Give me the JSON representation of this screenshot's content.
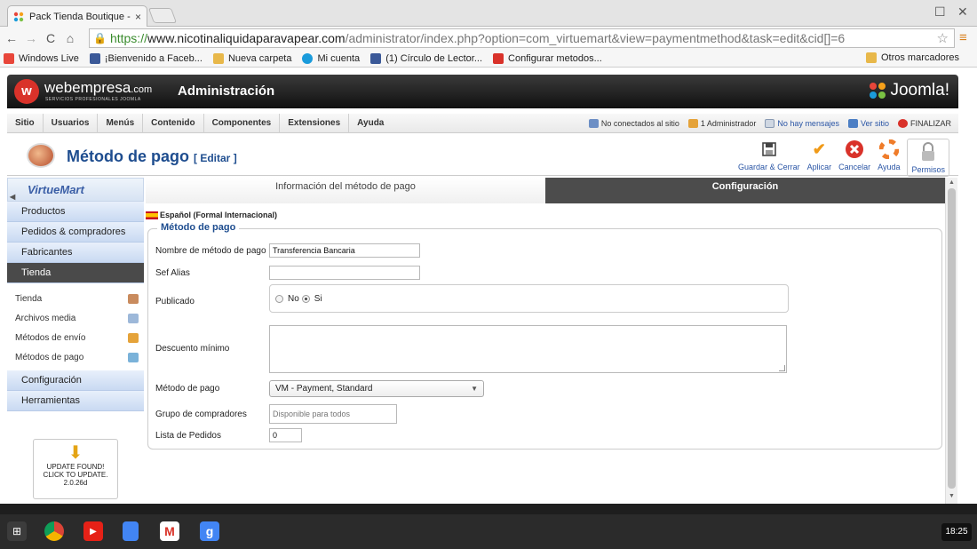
{
  "browser": {
    "tab_title": "Pack Tienda Boutique - Ad",
    "tab_close": "×",
    "url_scheme": "https://",
    "url_host": "www.nicotinaliquidaparavapear.com",
    "url_path": "/administrator/index.php?option=com_virtuemart&view=paymentmethod&task=edit&cid[]=6",
    "bookmarks": [
      {
        "label": "Windows Live",
        "color": "#e8463a"
      },
      {
        "label": "¡Bienvenido a Faceb...",
        "color": "#3b5998"
      },
      {
        "label": "Nueva carpeta",
        "color": "#e8b84a"
      },
      {
        "label": "Mi cuenta",
        "color": "#1a9bdb"
      },
      {
        "label": "(1) Círculo de Lector...",
        "color": "#3b5998"
      },
      {
        "label": "Configurar metodos...",
        "color": "#d9322a"
      }
    ],
    "other_bookmarks": "Otros marcadores"
  },
  "header": {
    "brand": "webempresa",
    "brand_suffix": ".com",
    "brand_sub": "SERVICIOS PROFESIONALES JOOMLA",
    "title": "Administración",
    "cms_logo": "Joomla!"
  },
  "menu": {
    "items": [
      "Sitio",
      "Usuarios",
      "Menús",
      "Contenido",
      "Componentes",
      "Extensiones",
      "Ayuda"
    ],
    "status": {
      "offline": "No conectados al sitio",
      "admins": "1 Administrador",
      "messages": "No hay mensajes",
      "view_site": "Ver sitio",
      "logout": "FINALIZAR"
    }
  },
  "toolbar": {
    "page_title": "Método de pago",
    "page_subtitle": "[ Editar ]",
    "buttons": [
      "Guardar & Cerrar",
      "Aplicar",
      "Cancelar",
      "Ayuda",
      "Permisos"
    ]
  },
  "sidebar": {
    "logo": "VirtueMart",
    "sections": [
      "Productos",
      "Pedidos & compradores",
      "Fabricantes",
      "Tienda",
      "Configuración",
      "Herramientas"
    ],
    "tienda_items": [
      "Tienda",
      "Archivos media",
      "Métodos de envío",
      "Métodos de pago"
    ],
    "update": {
      "line1": "UPDATE FOUND!",
      "line2": "CLICK TO UPDATE.",
      "line3": "2.0.26d"
    }
  },
  "main": {
    "tabs": [
      "Información del método de pago",
      "Configuración"
    ],
    "language": "Español (Formal Internacional)",
    "legend": "Método de pago",
    "fields": {
      "name_label": "Nombre de método de pago",
      "name_value": "Transferencia Bancaria",
      "alias_label": "Sef Alias",
      "alias_value": "",
      "published_label": "Publicado",
      "published_no": "No",
      "published_yes": "Si",
      "discount_label": "Descuento mínimo",
      "method_label": "Método de pago",
      "method_value": "VM - Payment, Standard",
      "group_label": "Grupo de compradores",
      "group_placeholder": "Disponible para todos",
      "order_label": "Lista de Pedidos",
      "order_value": "0"
    }
  },
  "taskbar": {
    "clock": "18:25"
  }
}
